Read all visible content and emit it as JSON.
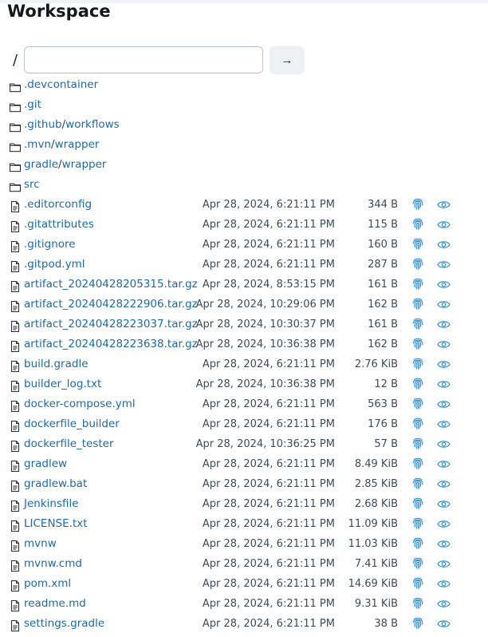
{
  "page": {
    "title": "Workspace"
  },
  "path_bar": {
    "separator": "/",
    "input_value": "",
    "go_button": "→"
  },
  "folders": [
    {
      "parts": [
        ".devcontainer"
      ]
    },
    {
      "parts": [
        ".git"
      ]
    },
    {
      "parts": [
        ".github",
        "workflows"
      ]
    },
    {
      "parts": [
        ".mvn",
        "wrapper"
      ]
    },
    {
      "parts": [
        "gradle",
        "wrapper"
      ]
    },
    {
      "parts": [
        "src"
      ]
    }
  ],
  "files": [
    {
      "name": ".editorconfig",
      "date": "Apr 28, 2024, 6:21:11 PM",
      "size": "344 B"
    },
    {
      "name": ".gitattributes",
      "date": "Apr 28, 2024, 6:21:11 PM",
      "size": "115 B"
    },
    {
      "name": ".gitignore",
      "date": "Apr 28, 2024, 6:21:11 PM",
      "size": "160 B"
    },
    {
      "name": ".gitpod.yml",
      "date": "Apr 28, 2024, 6:21:11 PM",
      "size": "287 B"
    },
    {
      "name": "artifact_20240428205315.tar.gz",
      "date": "Apr 28, 2024, 8:53:15 PM",
      "size": "161 B"
    },
    {
      "name": "artifact_20240428222906.tar.gz",
      "date": "Apr 28, 2024, 10:29:06 PM",
      "size": "162 B"
    },
    {
      "name": "artifact_20240428223037.tar.gz",
      "date": "Apr 28, 2024, 10:30:37 PM",
      "size": "161 B"
    },
    {
      "name": "artifact_20240428223638.tar.gz",
      "date": "Apr 28, 2024, 10:36:38 PM",
      "size": "162 B"
    },
    {
      "name": "build.gradle",
      "date": "Apr 28, 2024, 6:21:11 PM",
      "size": "2.76 KiB"
    },
    {
      "name": "builder_log.txt",
      "date": "Apr 28, 2024, 10:36:38 PM",
      "size": "12 B"
    },
    {
      "name": "docker-compose.yml",
      "date": "Apr 28, 2024, 6:21:11 PM",
      "size": "563 B"
    },
    {
      "name": "dockerfile_builder",
      "date": "Apr 28, 2024, 6:21:11 PM",
      "size": "176 B"
    },
    {
      "name": "dockerfile_tester",
      "date": "Apr 28, 2024, 10:36:25 PM",
      "size": "57 B"
    },
    {
      "name": "gradlew",
      "date": "Apr 28, 2024, 6:21:11 PM",
      "size": "8.49 KiB"
    },
    {
      "name": "gradlew.bat",
      "date": "Apr 28, 2024, 6:21:11 PM",
      "size": "2.85 KiB"
    },
    {
      "name": "Jenkinsfile",
      "date": "Apr 28, 2024, 6:21:11 PM",
      "size": "2.68 KiB"
    },
    {
      "name": "LICENSE.txt",
      "date": "Apr 28, 2024, 6:21:11 PM",
      "size": "11.09 KiB"
    },
    {
      "name": "mvnw",
      "date": "Apr 28, 2024, 6:21:11 PM",
      "size": "11.03 KiB"
    },
    {
      "name": "mvnw.cmd",
      "date": "Apr 28, 2024, 6:21:11 PM",
      "size": "7.41 KiB"
    },
    {
      "name": "pom.xml",
      "date": "Apr 28, 2024, 6:21:11 PM",
      "size": "14.69 KiB"
    },
    {
      "name": "readme.md",
      "date": "Apr 28, 2024, 6:21:11 PM",
      "size": "9.31 KiB"
    },
    {
      "name": "settings.gradle",
      "date": "Apr 28, 2024, 6:21:11 PM",
      "size": "38 B"
    }
  ],
  "icons": {
    "folder": "folder-icon",
    "file": "file-icon",
    "fingerprint": "fingerprint-icon",
    "view": "eye-icon"
  },
  "colors": {
    "link": "#1b6aa8",
    "action_icon": "#2a8bd3",
    "text": "#3e4a56"
  }
}
